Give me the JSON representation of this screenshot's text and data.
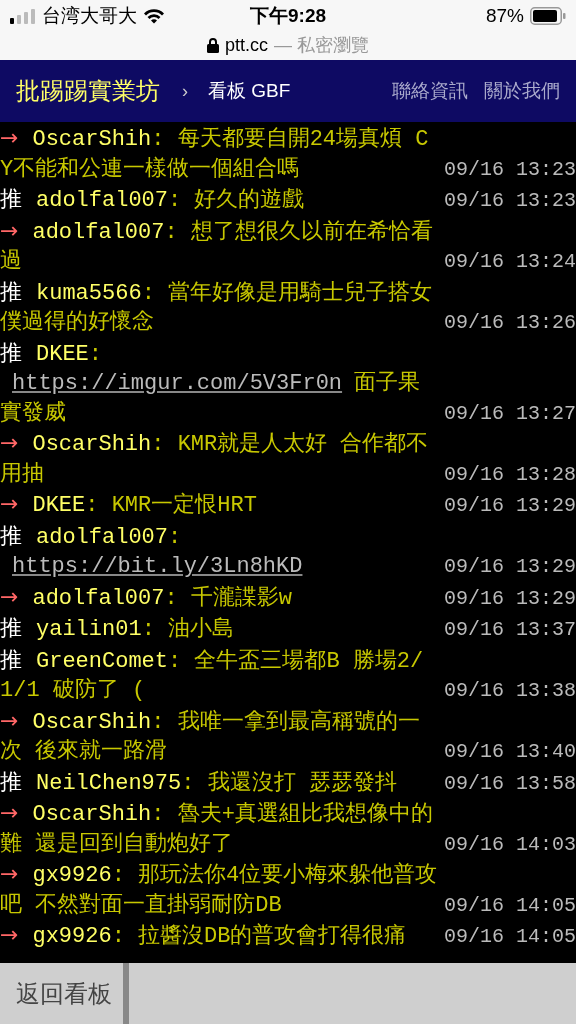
{
  "status_bar": {
    "carrier": "台湾大哥大",
    "time": "下午9:28",
    "battery": "87%"
  },
  "address_bar": {
    "domain": "ptt.cc",
    "mode": "— 私密瀏覽"
  },
  "header": {
    "site_title": "批踢踢實業坊",
    "separator": "›",
    "board": "看板 GBF",
    "links": [
      "聯絡資訊",
      "關於我們"
    ]
  },
  "pushes": [
    {
      "kind": "arrow",
      "tag": "→",
      "user": "OscarShih",
      "content": [
        {
          "kind": "text",
          "text": ": 每天都要自開24場真煩 CY不能和公連一樣做一個組合嗎"
        }
      ],
      "time": "09/16 13:23"
    },
    {
      "kind": "push",
      "tag": "推",
      "user": "adolfal007",
      "content": [
        {
          "kind": "text",
          "text": ": 好久的遊戲"
        }
      ],
      "time": "09/16 13:23"
    },
    {
      "kind": "arrow",
      "tag": "→",
      "user": "adolfal007",
      "content": [
        {
          "kind": "text",
          "text": ": 想了想很久以前在希恰看過"
        }
      ],
      "time": "09/16 13:24"
    },
    {
      "kind": "push",
      "tag": "推",
      "user": "kuma5566",
      "content": [
        {
          "kind": "text",
          "text": ": 當年好像是用騎士兒子搭女僕過得的好懷念"
        }
      ],
      "time": "09/16 13:26"
    },
    {
      "kind": "push",
      "tag": "推",
      "user": "DKEE",
      "content": [
        {
          "kind": "text",
          "text": ":"
        },
        {
          "kind": "link",
          "text": "https://imgur.com/5V3Fr0n"
        },
        {
          "kind": "text",
          "text": "面子果實發威"
        }
      ],
      "time": "09/16 13:27"
    },
    {
      "kind": "arrow",
      "tag": "→",
      "user": "OscarShih",
      "content": [
        {
          "kind": "text",
          "text": ": KMR就是人太好 合作都不用抽"
        }
      ],
      "time": "09/16 13:28"
    },
    {
      "kind": "arrow",
      "tag": "→",
      "user": "DKEE",
      "content": [
        {
          "kind": "text",
          "text": ": KMR一定恨HRT"
        }
      ],
      "time": "09/16 13:29"
    },
    {
      "kind": "push",
      "tag": "推",
      "user": "adolfal007",
      "content": [
        {
          "kind": "text",
          "text": ":"
        },
        {
          "kind": "link",
          "text": "https://bit.ly/3Ln8hKD"
        }
      ],
      "time": "09/16 13:29"
    },
    {
      "kind": "arrow",
      "tag": "→",
      "user": "adolfal007",
      "content": [
        {
          "kind": "text",
          "text": ": 千瀧諜影w"
        }
      ],
      "time": "09/16 13:29"
    },
    {
      "kind": "push",
      "tag": "推",
      "user": "yailin01",
      "content": [
        {
          "kind": "text",
          "text": ": 油小島"
        }
      ],
      "time": "09/16 13:37"
    },
    {
      "kind": "push",
      "tag": "推",
      "user": "GreenComet",
      "content": [
        {
          "kind": "text",
          "text": ": 全牛盃三場都B 勝場2/1/1 破防了 ("
        }
      ],
      "time": "09/16 13:38"
    },
    {
      "kind": "arrow",
      "tag": "→",
      "user": "OscarShih",
      "content": [
        {
          "kind": "text",
          "text": ": 我唯一拿到最高稱號的一次 後來就一路滑"
        }
      ],
      "time": "09/16 13:40"
    },
    {
      "kind": "push",
      "tag": "推",
      "user": "NeilChen975",
      "content": [
        {
          "kind": "text",
          "text": ": 我還沒打 瑟瑟發抖"
        }
      ],
      "time": "09/16 13:58"
    },
    {
      "kind": "arrow",
      "tag": "→",
      "user": "OscarShih",
      "content": [
        {
          "kind": "text",
          "text": ": 魯夫+真選組比我想像中的難 還是回到自動炮好了"
        }
      ],
      "time": "09/16 14:03"
    },
    {
      "kind": "arrow",
      "tag": "→",
      "user": "gx9926",
      "content": [
        {
          "kind": "text",
          "text": ": 那玩法你4位要小梅來躲他普攻吧 不然對面一直掛弱耐防DB"
        }
      ],
      "time": "09/16 14:05"
    },
    {
      "kind": "arrow",
      "tag": "→",
      "user": "gx9926",
      "content": [
        {
          "kind": "text",
          "text": ": 拉醬沒DB的普攻會打得很痛"
        }
      ],
      "time": "09/16 14:05"
    }
  ],
  "bottom_bar": {
    "back_button": "返回看板"
  }
}
